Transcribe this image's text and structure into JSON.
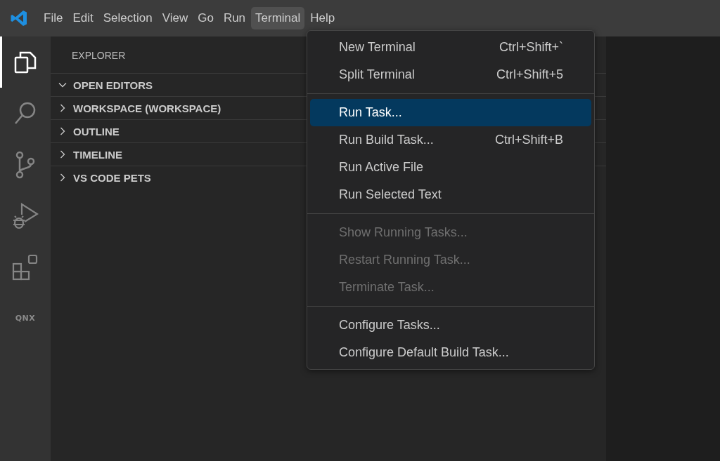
{
  "menu_bar": [
    {
      "label": "File",
      "selected": false
    },
    {
      "label": "Edit",
      "selected": false
    },
    {
      "label": "Selection",
      "selected": false
    },
    {
      "label": "View",
      "selected": false
    },
    {
      "label": "Go",
      "selected": false
    },
    {
      "label": "Run",
      "selected": false
    },
    {
      "label": "Terminal",
      "selected": true
    },
    {
      "label": "Help",
      "selected": false
    }
  ],
  "activity_bar": [
    {
      "kind": "explorer",
      "selected": true
    },
    {
      "kind": "search",
      "selected": false
    },
    {
      "kind": "source-control",
      "selected": false
    },
    {
      "kind": "run-debug",
      "selected": false
    },
    {
      "kind": "extensions",
      "selected": false
    },
    {
      "kind": "qnx",
      "selected": false,
      "label": "QNX"
    }
  ],
  "sidebar": {
    "title": "EXPLORER",
    "sections": [
      {
        "label": "OPEN EDITORS",
        "expanded": true
      },
      {
        "label": "WORKSPACE (WORKSPACE)",
        "expanded": false
      },
      {
        "label": "OUTLINE",
        "expanded": false
      },
      {
        "label": "TIMELINE",
        "expanded": false
      },
      {
        "label": "VS CODE PETS",
        "expanded": false
      }
    ]
  },
  "terminal_menu": [
    {
      "kind": "item",
      "label": "New Terminal",
      "shortcut": "Ctrl+Shift+`",
      "selected": false,
      "disabled": false
    },
    {
      "kind": "item",
      "label": "Split Terminal",
      "shortcut": "Ctrl+Shift+5",
      "selected": false,
      "disabled": false
    },
    {
      "kind": "separator"
    },
    {
      "kind": "item",
      "label": "Run Task...",
      "selected": true,
      "disabled": false
    },
    {
      "kind": "item",
      "label": "Run Build Task...",
      "shortcut": "Ctrl+Shift+B",
      "selected": false,
      "disabled": false
    },
    {
      "kind": "item",
      "label": "Run Active File",
      "selected": false,
      "disabled": false
    },
    {
      "kind": "item",
      "label": "Run Selected Text",
      "selected": false,
      "disabled": false
    },
    {
      "kind": "separator"
    },
    {
      "kind": "item",
      "label": "Show Running Tasks...",
      "selected": false,
      "disabled": true
    },
    {
      "kind": "item",
      "label": "Restart Running Task...",
      "selected": false,
      "disabled": true
    },
    {
      "kind": "item",
      "label": "Terminate Task...",
      "selected": false,
      "disabled": true
    },
    {
      "kind": "separator"
    },
    {
      "kind": "item",
      "label": "Configure Tasks...",
      "selected": false,
      "disabled": false
    },
    {
      "kind": "item",
      "label": "Configure Default Build Task...",
      "selected": false,
      "disabled": false
    }
  ]
}
